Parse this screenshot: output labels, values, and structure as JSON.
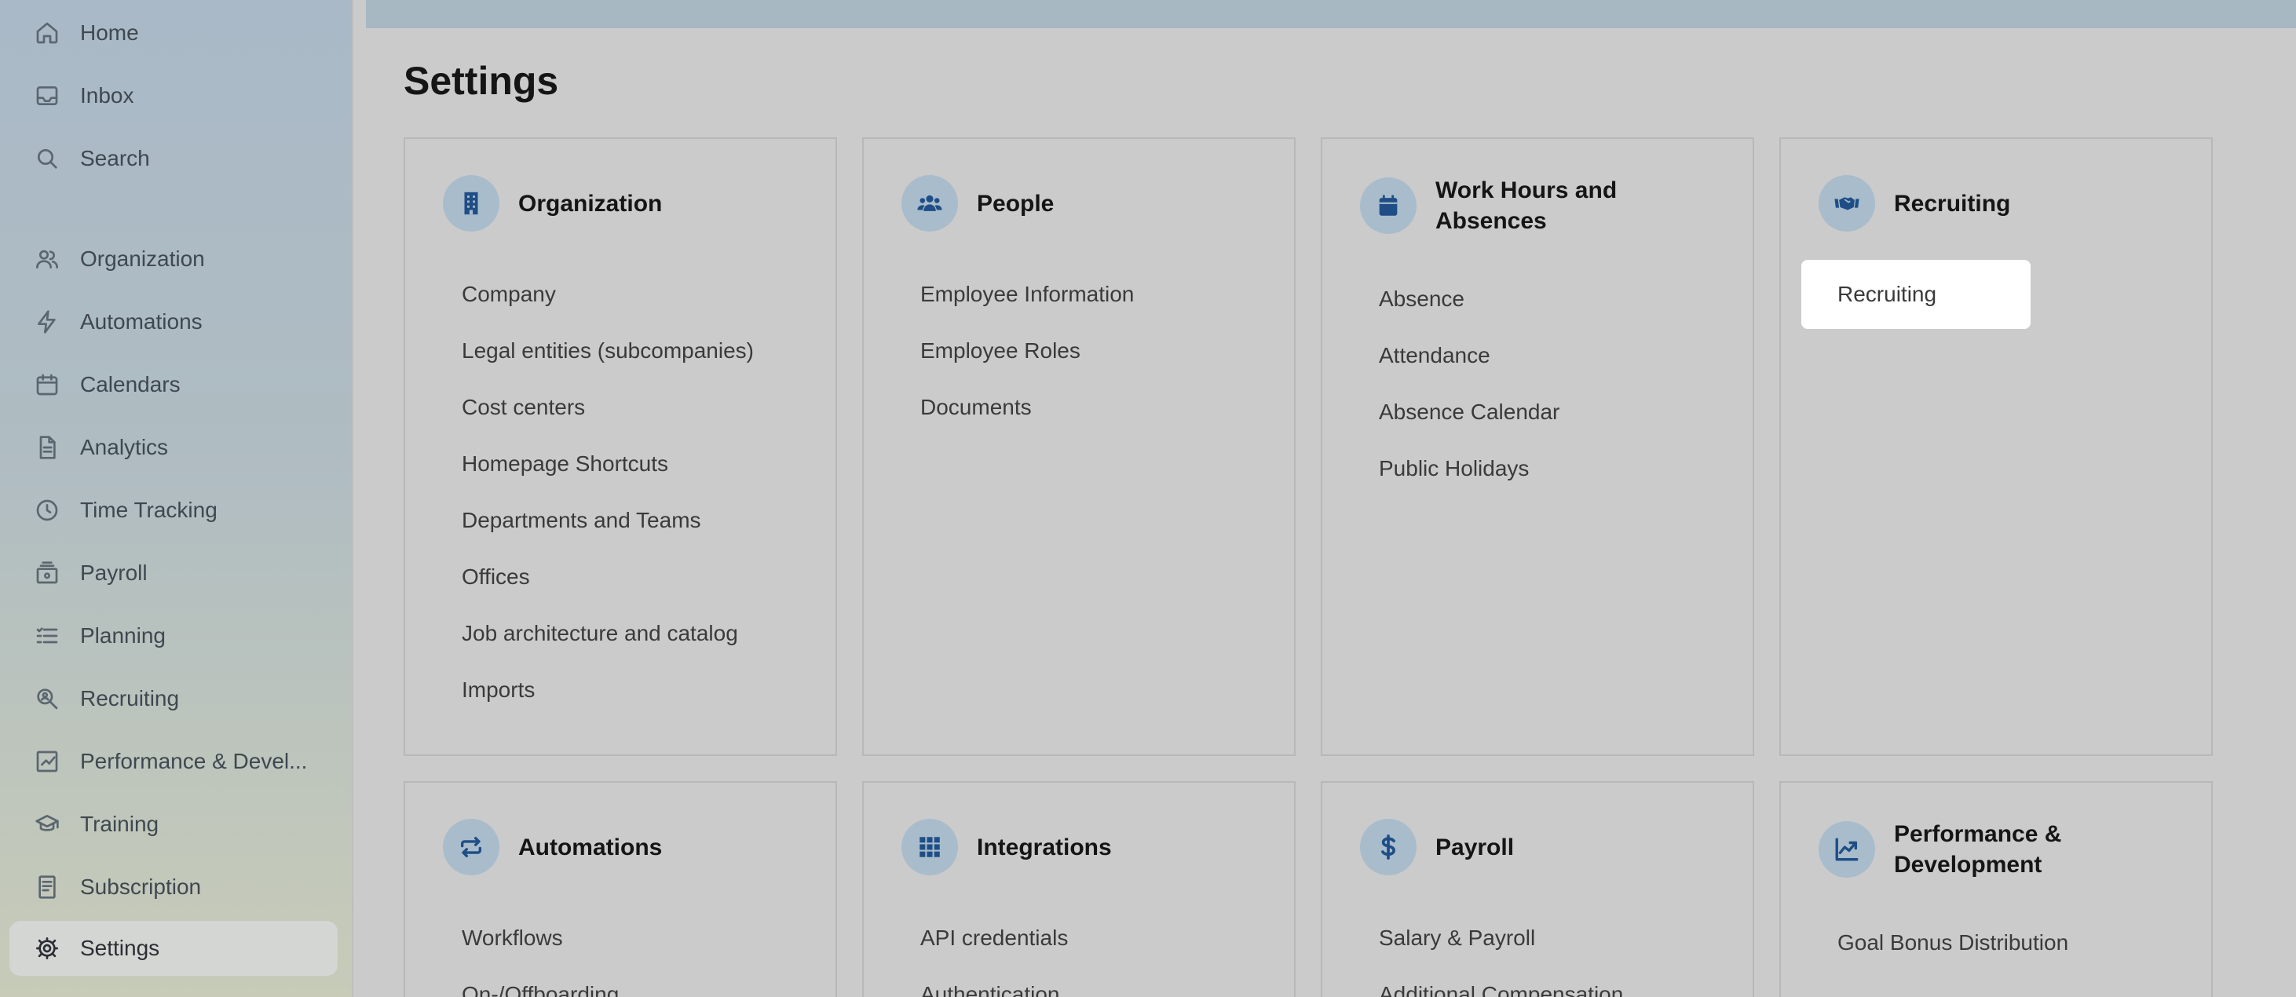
{
  "sidebar": {
    "items": [
      {
        "label": "Home",
        "icon": "home-icon"
      },
      {
        "label": "Inbox",
        "icon": "inbox-icon"
      },
      {
        "label": "Search",
        "icon": "search-icon"
      },
      {
        "label": "Organization",
        "icon": "people-icon"
      },
      {
        "label": "Automations",
        "icon": "lightning-icon"
      },
      {
        "label": "Calendars",
        "icon": "calendar-icon"
      },
      {
        "label": "Analytics",
        "icon": "document-icon"
      },
      {
        "label": "Time Tracking",
        "icon": "clock-icon"
      },
      {
        "label": "Payroll",
        "icon": "payroll-icon"
      },
      {
        "label": "Planning",
        "icon": "list-icon"
      },
      {
        "label": "Recruiting",
        "icon": "recruiting-icon"
      },
      {
        "label": "Performance & Devel...",
        "icon": "chart-icon"
      },
      {
        "label": "Training",
        "icon": "graduation-cap-icon"
      },
      {
        "label": "Subscription",
        "icon": "receipt-icon"
      },
      {
        "label": "Settings",
        "icon": "gear-icon",
        "active": true
      }
    ]
  },
  "main": {
    "title": "Settings",
    "cards": [
      {
        "title": "Organization",
        "icon": "building-icon",
        "links": [
          "Company",
          "Legal entities (subcompanies)",
          "Cost centers",
          "Homepage Shortcuts",
          "Departments and Teams",
          "Offices",
          "Job architecture and catalog",
          "Imports"
        ]
      },
      {
        "title": "People",
        "icon": "users-icon",
        "links": [
          "Employee Information",
          "Employee Roles",
          "Documents"
        ]
      },
      {
        "title": "Work Hours and Absences",
        "icon": "calendar-icon",
        "links": [
          "Absence",
          "Attendance",
          "Absence Calendar",
          "Public Holidays"
        ]
      },
      {
        "title": "Recruiting",
        "icon": "handshake-icon",
        "links": [
          "Recruiting"
        ]
      },
      {
        "title": "Automations",
        "icon": "repeat-icon",
        "links": [
          "Workflows",
          "On-/Offboarding"
        ]
      },
      {
        "title": "Integrations",
        "icon": "grid-icon",
        "links": [
          "API credentials",
          "Authentication"
        ]
      },
      {
        "title": "Payroll",
        "icon": "dollar-icon",
        "links": [
          "Salary & Payroll",
          "Additional Compensation"
        ]
      },
      {
        "title": "Performance & Development",
        "icon": "chart-line-icon",
        "links": [
          "Goal Bonus Distribution"
        ]
      }
    ]
  },
  "colors": {
    "accent": "#1f4e86",
    "icon_bg": "#a8bccb",
    "card_border": "#b8b8b8"
  }
}
